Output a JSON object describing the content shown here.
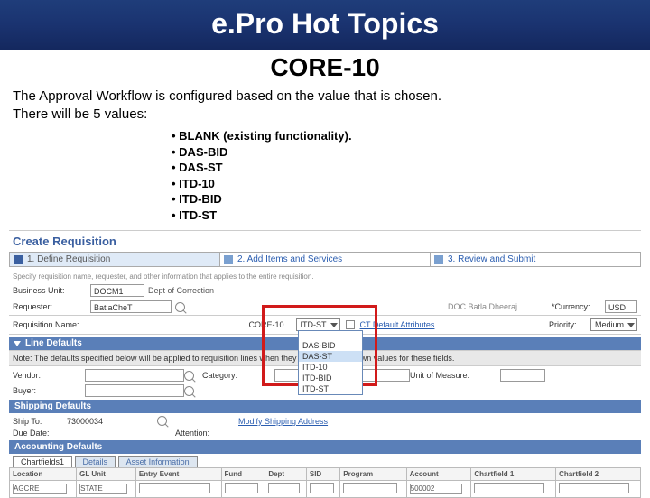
{
  "title": {
    "main": "e.Pro Hot Topics",
    "sub": "CORE-10"
  },
  "description": {
    "line1": "The Approval Workflow is configured based on the value that is chosen.",
    "line2": "There will be 5 values:"
  },
  "values": [
    "• BLANK (existing functionality).",
    "• DAS-BID",
    "• DAS-ST",
    "• ITD-10",
    "• ITD-BID",
    "• ITD-ST"
  ],
  "app": {
    "create_title": "Create Requisition",
    "steps": {
      "s1": "1. Define Requisition",
      "s2": "2. Add Items and Services",
      "s3": "3. Review and Submit"
    },
    "blur_intro": "Specify requisition name, requester, and other information that applies to the entire requisition.",
    "labels": {
      "business_unit": "Business Unit:",
      "requester": "Requester:",
      "requisition_name": "Requisition Name:",
      "currency": "*Currency:",
      "priority": "Priority:",
      "core10": "CORE-10",
      "vendor": "Vendor:",
      "buyer": "Buyer:",
      "category": "Category:",
      "uom": "Unit of Measure:",
      "ship_to": "Ship To:",
      "due_date": "Due Date:",
      "attention": "Attention:",
      "modify_link": "Modify Shipping Address",
      "location": "Location",
      "gl_unit": "GL Unit",
      "entry_event": "Entry Event",
      "fund": "Fund",
      "dept": "Dept",
      "sid": "SID",
      "program": "Program",
      "account": "Account",
      "cf1": "Chartfield 1",
      "cf2": "Chartfield 2"
    },
    "values": {
      "business_unit": "DOCM1",
      "bu_desc": "Dept of Correction",
      "requester": "BatlaCheT",
      "core10_selected": "ITD-ST",
      "currency": "USD",
      "priority": "Medium",
      "ship_to": "73000034",
      "gl_unit": "STATE",
      "account": "500002",
      "loc": "AGCRE"
    },
    "dropdown_items": [
      "",
      "DAS-BID",
      "DAS-ST",
      "ITD-10",
      "ITD-BID",
      "ITD-ST"
    ],
    "note": "Note: The defaults specified below will be applied to requisition lines when they don't have their own values for these fields.",
    "headers": {
      "line_defaults": "Line Defaults",
      "shipping_defaults": "Shipping Defaults",
      "acct_defaults": "Accounting Defaults",
      "tab_chartfields": "Chartfields1",
      "tab_details": "Details",
      "tab_asset": "Asset Information"
    },
    "req_defaults_label": "CT Default Attributes"
  }
}
